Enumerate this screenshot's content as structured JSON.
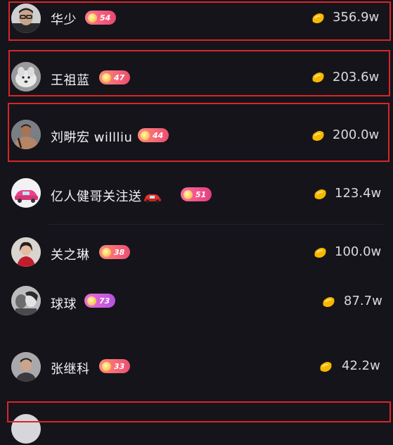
{
  "colors": {
    "background": "#15141b",
    "highlight_border": "#d8252a",
    "badge_pink": "#ee4f7e",
    "badge_purple": "#c253d8",
    "coin": "#f5b800"
  },
  "rank_list": [
    {
      "name": "华少",
      "level": "54",
      "amount": "356.9w",
      "avatar_icon": "avatar-man-glasses"
    },
    {
      "name": "王祖蓝",
      "level": "47",
      "amount": "203.6w",
      "avatar_icon": "avatar-white-dog"
    },
    {
      "name": "刘畊宏 willliu",
      "level": "44",
      "amount": "200.0w",
      "avatar_icon": "avatar-man-shirtless"
    },
    {
      "name": "亿人健哥关注送",
      "level": "51",
      "amount": "123.4w",
      "avatar_icon": "avatar-pink-car",
      "name_suffix_icon": "red-car-emoji"
    },
    {
      "name": "关之琳",
      "level": "38",
      "amount": "100.0w",
      "avatar_icon": "avatar-woman-red"
    },
    {
      "name": "球球",
      "level": "73",
      "amount": "87.7w",
      "avatar_icon": "avatar-couple-bw"
    },
    {
      "name": "张继科",
      "level": "33",
      "amount": "42.2w",
      "avatar_icon": "avatar-man-portrait"
    }
  ]
}
